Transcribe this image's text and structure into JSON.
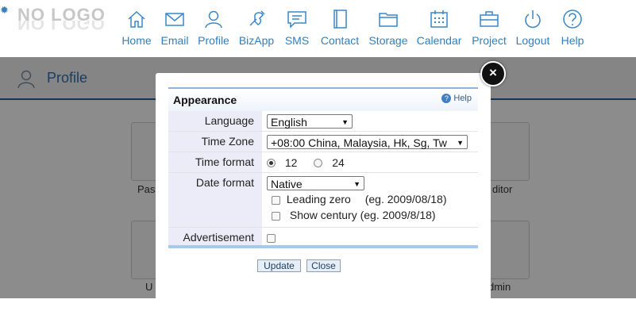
{
  "logo": {
    "text": "NO LOGO"
  },
  "nav": {
    "items": [
      {
        "label": "Home",
        "icon": "home-icon"
      },
      {
        "label": "Email",
        "icon": "email-icon"
      },
      {
        "label": "Profile",
        "icon": "profile-icon"
      },
      {
        "label": "BizApp",
        "icon": "bizapp-icon"
      },
      {
        "label": "SMS",
        "icon": "sms-icon"
      },
      {
        "label": "Contact",
        "icon": "contact-icon"
      },
      {
        "label": "Storage",
        "icon": "storage-icon"
      },
      {
        "label": "Calendar",
        "icon": "calendar-icon"
      },
      {
        "label": "Project",
        "icon": "project-icon"
      },
      {
        "label": "Logout",
        "icon": "logout-icon"
      },
      {
        "label": "Help",
        "icon": "help-icon"
      }
    ]
  },
  "page": {
    "title": "Profile",
    "tiles_visible_text": [
      "Pas",
      "ditor",
      "U",
      "dmin"
    ]
  },
  "dialog": {
    "title": "Appearance",
    "help_label": "Help",
    "close_symbol": "×",
    "fields": {
      "language": {
        "label": "Language",
        "value": "English"
      },
      "time_zone": {
        "label": "Time Zone",
        "value": "+08:00 China, Malaysia, Hk, Sg, Tw"
      },
      "time_format": {
        "label": "Time format",
        "option_12": "12",
        "option_24": "24",
        "selected": "12"
      },
      "date_format": {
        "label": "Date format",
        "value": "Native",
        "leading_zero_label": "Leading zero",
        "leading_zero_example": "(eg. 2009/08/18)",
        "show_century_label": "Show century (eg. 2009/8/18)"
      },
      "advertisement": {
        "label": "Advertisement"
      }
    },
    "buttons": {
      "update": "Update",
      "close": "Close"
    }
  },
  "colors": {
    "accent": "#2f7fbf",
    "header_rule": "#2b5fa8",
    "label_bg": "#ececf8"
  }
}
